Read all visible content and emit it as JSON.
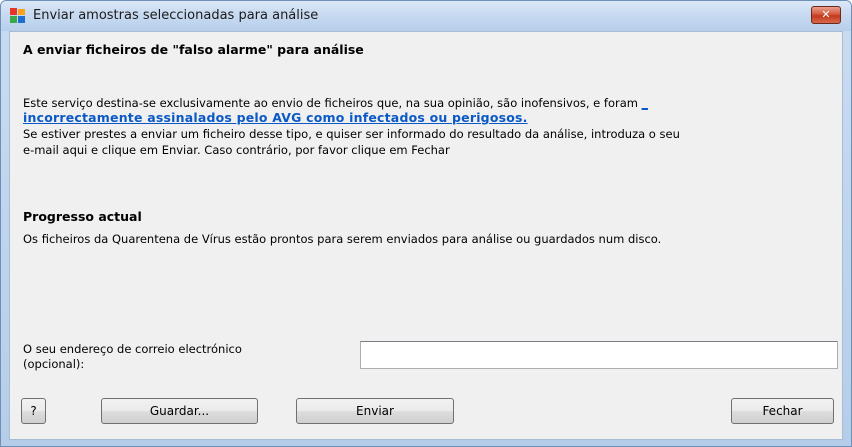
{
  "window": {
    "title": "Enviar amostras seleccionadas para análise",
    "close_glyph": "✕",
    "icon": "avg-app-icon"
  },
  "intro": {
    "heading": "A enviar ficheiros de  \"falso alarme\" para análise",
    "line1": "Este serviço destina-se exclusivamente ao envio de ficheiros que, na sua opinião, são inofensivos, e foram ",
    "link_lead": "_",
    "link": "incorrectamente assinalados pelo AVG como infectados ou perigosos.",
    "line2": " Se estiver prestes a enviar um ficheiro desse tipo, e quiser ser informado do resultado da análise, introduza o seu",
    "line3": "e-mail aqui e clique em Enviar. Caso contrário, por favor clique em Fechar"
  },
  "progress": {
    "title": "Progresso actual",
    "text": "Os ficheiros da Quarentena de Vírus estão prontos para serem enviados para análise ou guardados num disco."
  },
  "email": {
    "label_line1": "O seu endereço de correio electrónico",
    "label_line2": "(opcional):",
    "value": ""
  },
  "buttons": {
    "help": "?",
    "save": "Guardar...",
    "send": "Enviar",
    "close": "Fechar"
  }
}
